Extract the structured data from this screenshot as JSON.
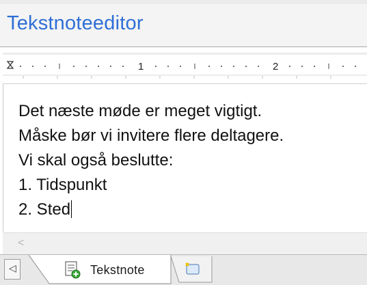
{
  "window": {
    "title": "Tekstnoteeditor"
  },
  "ruler": {
    "labels": [
      "1",
      "2"
    ]
  },
  "editor": {
    "lines": [
      "Det næste møde er meget vigtigt.",
      "Måske bør vi invitere flere deltagere.",
      "Vi skal også beslutte:",
      "1. Tidspunkt",
      "2. Sted"
    ]
  },
  "tabs": {
    "active_label": "Tekstnote"
  },
  "icons": {
    "tab_scroll_left": "triangle-left-icon",
    "note_tab": "note-add-icon",
    "new_tab": "new-note-icon",
    "scroll_left": "scroll-left-icon"
  },
  "colors": {
    "title": "#2f6fd6",
    "text": "#111111"
  }
}
